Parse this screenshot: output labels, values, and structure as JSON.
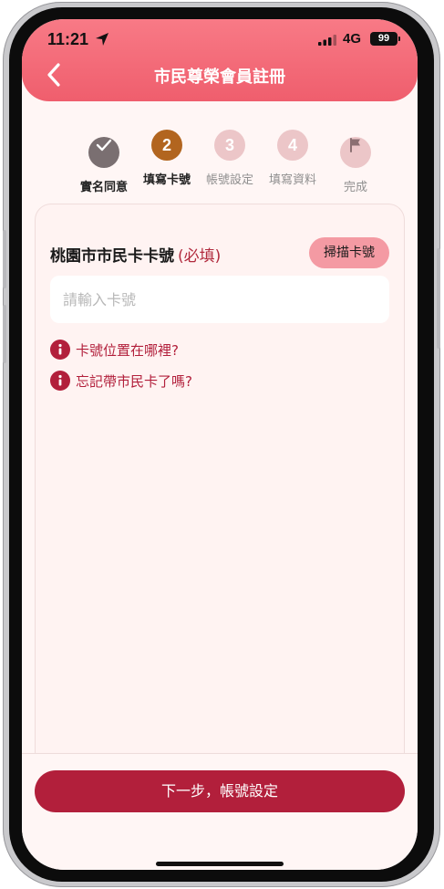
{
  "status_bar": {
    "time": "11:21",
    "network": "4G",
    "battery": "99"
  },
  "header": {
    "title": "市民尊榮會員註冊"
  },
  "stepper": {
    "steps": [
      {
        "label": "實名同意",
        "number": "",
        "state": "done"
      },
      {
        "label": "填寫卡號",
        "number": "2",
        "state": "active"
      },
      {
        "label": "帳號設定",
        "number": "3",
        "state": "todo"
      },
      {
        "label": "填寫資料",
        "number": "4",
        "state": "todo"
      },
      {
        "label": "完成",
        "number": "",
        "state": "todo"
      }
    ]
  },
  "card": {
    "field_label": "桃園市市民卡卡號",
    "required_label": "(必填)",
    "scan_button": "掃描卡號",
    "input_placeholder": "請輸入卡號",
    "input_value": "",
    "help_links": [
      "卡號位置在哪裡?",
      "忘記帶市民卡了嗎?"
    ]
  },
  "footer": {
    "next_button": "下一步，帳號設定"
  },
  "colors": {
    "header": "#f06473",
    "primary": "#b21f3b",
    "step_done": "#7a6f71",
    "step_active": "#b2651f",
    "step_todo": "#ecc6c8",
    "scan_button": "#f49aa3",
    "background": "#fff6f5"
  },
  "icons": {
    "back": "chevron-left-icon",
    "location": "location-arrow-icon",
    "signal": "signal-bars-icon",
    "done_step": "check-icon",
    "finish_step": "flag-icon",
    "help": "info-icon"
  }
}
